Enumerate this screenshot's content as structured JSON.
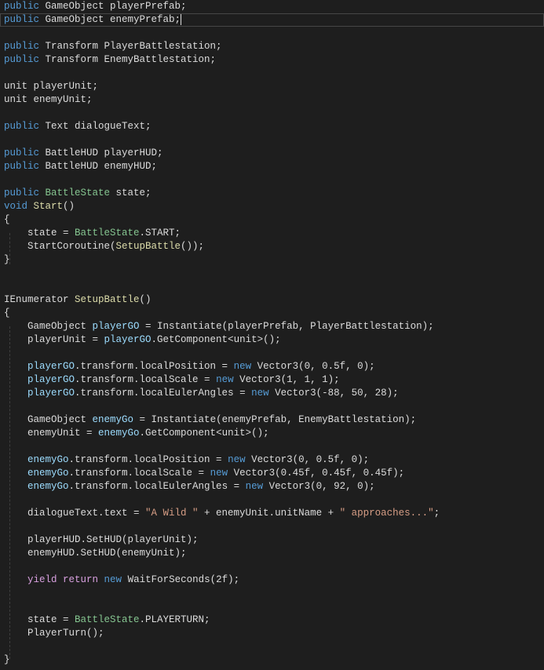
{
  "editor": {
    "current_line": 1,
    "lines": [
      [
        [
          "public",
          "k"
        ],
        [
          " GameObject playerPrefab;",
          "t"
        ]
      ],
      [
        [
          "public",
          "k"
        ],
        [
          " GameObject enemyPrefab;",
          "t"
        ]
      ],
      [],
      [
        [
          "public",
          "k"
        ],
        [
          " Transform PlayerBattlestation;",
          "t"
        ]
      ],
      [
        [
          "public",
          "k"
        ],
        [
          " Transform EnemyBattlestation;",
          "t"
        ]
      ],
      [],
      [
        [
          "unit playerUnit;",
          "t"
        ]
      ],
      [
        [
          "unit enemyUnit;",
          "t"
        ]
      ],
      [],
      [
        [
          "public",
          "k"
        ],
        [
          " Text dialogueText;",
          "t"
        ]
      ],
      [],
      [
        [
          "public",
          "k"
        ],
        [
          " BattleHUD playerHUD;",
          "t"
        ]
      ],
      [
        [
          "public",
          "k"
        ],
        [
          " BattleHUD enemyHUD;",
          "t"
        ]
      ],
      [],
      [
        [
          "public",
          "k"
        ],
        [
          " ",
          "t"
        ],
        [
          "BattleState",
          "c"
        ],
        [
          " state;",
          "t"
        ]
      ],
      [
        [
          "void",
          "k"
        ],
        [
          " ",
          "t"
        ],
        [
          "Start",
          "f"
        ],
        [
          "()",
          "t"
        ]
      ],
      [
        [
          "{",
          "t"
        ]
      ],
      [
        [
          "    state = ",
          "t"
        ],
        [
          "BattleState",
          "c"
        ],
        [
          ".START;",
          "t"
        ]
      ],
      [
        [
          "    StartCoroutine(",
          "t"
        ],
        [
          "SetupBattle",
          "f"
        ],
        [
          "());",
          "t"
        ]
      ],
      [
        [
          "}",
          "t"
        ]
      ],
      [],
      [],
      [
        [
          "IEnumerator ",
          "t"
        ],
        [
          "SetupBattle",
          "f"
        ],
        [
          "()",
          "t"
        ]
      ],
      [
        [
          "{",
          "t"
        ]
      ],
      [
        [
          "    GameObject ",
          "t"
        ],
        [
          "playerGO",
          "v"
        ],
        [
          " = Instantiate(playerPrefab, PlayerBattlestation);",
          "t"
        ]
      ],
      [
        [
          "    playerUnit = ",
          "t"
        ],
        [
          "playerGO",
          "v"
        ],
        [
          ".GetComponent<unit>();",
          "t"
        ]
      ],
      [],
      [
        [
          "    ",
          "t"
        ],
        [
          "playerGO",
          "v"
        ],
        [
          ".transform.localPosition = ",
          "t"
        ],
        [
          "new",
          "k"
        ],
        [
          " Vector3(0, 0.5f, 0);",
          "t"
        ]
      ],
      [
        [
          "    ",
          "t"
        ],
        [
          "playerGO",
          "v"
        ],
        [
          ".transform.localScale = ",
          "t"
        ],
        [
          "new",
          "k"
        ],
        [
          " Vector3(1, 1, 1);",
          "t"
        ]
      ],
      [
        [
          "    ",
          "t"
        ],
        [
          "playerGO",
          "v"
        ],
        [
          ".transform.localEulerAngles = ",
          "t"
        ],
        [
          "new",
          "k"
        ],
        [
          " Vector3(-88, 50, 28);",
          "t"
        ]
      ],
      [],
      [
        [
          "    GameObject ",
          "t"
        ],
        [
          "enemyGo",
          "v"
        ],
        [
          " = Instantiate(enemyPrefab, EnemyBattlestation);",
          "t"
        ]
      ],
      [
        [
          "    enemyUnit = ",
          "t"
        ],
        [
          "enemyGo",
          "v"
        ],
        [
          ".GetComponent<unit>();",
          "t"
        ]
      ],
      [],
      [
        [
          "    ",
          "t"
        ],
        [
          "enemyGo",
          "v"
        ],
        [
          ".transform.localPosition = ",
          "t"
        ],
        [
          "new",
          "k"
        ],
        [
          " Vector3(0, 0.5f, 0);",
          "t"
        ]
      ],
      [
        [
          "    ",
          "t"
        ],
        [
          "enemyGo",
          "v"
        ],
        [
          ".transform.localScale = ",
          "t"
        ],
        [
          "new",
          "k"
        ],
        [
          " Vector3(0.45f, 0.45f, 0.45f);",
          "t"
        ]
      ],
      [
        [
          "    ",
          "t"
        ],
        [
          "enemyGo",
          "v"
        ],
        [
          ".transform.localEulerAngles = ",
          "t"
        ],
        [
          "new",
          "k"
        ],
        [
          " Vector3(0, 92, 0);",
          "t"
        ]
      ],
      [],
      [
        [
          "    dialogueText.text = ",
          "t"
        ],
        [
          "\"A Wild \"",
          "s"
        ],
        [
          " + enemyUnit.unitName + ",
          "t"
        ],
        [
          "\" approaches...\"",
          "s"
        ],
        [
          ";",
          "t"
        ]
      ],
      [],
      [
        [
          "    playerHUD.SetHUD(playerUnit);",
          "t"
        ]
      ],
      [
        [
          "    enemyHUD.SetHUD(enemyUnit);",
          "t"
        ]
      ],
      [],
      [
        [
          "    ",
          "t"
        ],
        [
          "yield return",
          "p"
        ],
        [
          " ",
          "t"
        ],
        [
          "new",
          "k"
        ],
        [
          " WaitForSeconds(2f);",
          "t"
        ]
      ],
      [],
      [],
      [
        [
          "    state = ",
          "t"
        ],
        [
          "BattleState",
          "c"
        ],
        [
          ".PLAYERTURN;",
          "t"
        ]
      ],
      [
        [
          "    PlayerTurn();",
          "t"
        ]
      ],
      [],
      [
        [
          "}",
          "t"
        ]
      ]
    ]
  }
}
